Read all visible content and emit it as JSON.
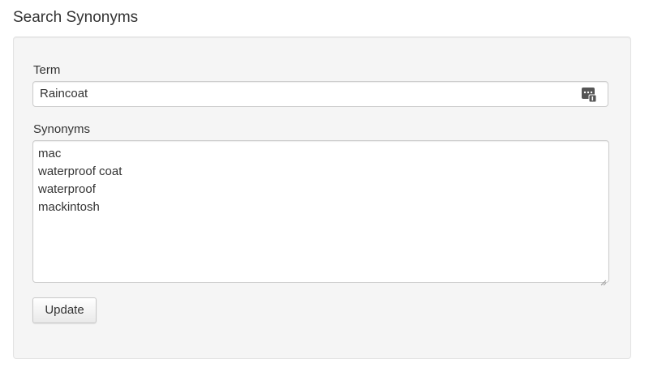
{
  "page": {
    "title": "Search Synonyms"
  },
  "form": {
    "term_label": "Term",
    "term_value": "Raincoat",
    "term_icon": "password-manager-icon",
    "synonyms_label": "Synonyms",
    "synonyms": [
      "mac",
      "waterproof coat",
      "waterproof",
      "mackintosh"
    ],
    "update_label": "Update"
  },
  "colors": {
    "well_background": "#f5f5f5",
    "input_border": "#cccccc",
    "text": "#333333"
  }
}
